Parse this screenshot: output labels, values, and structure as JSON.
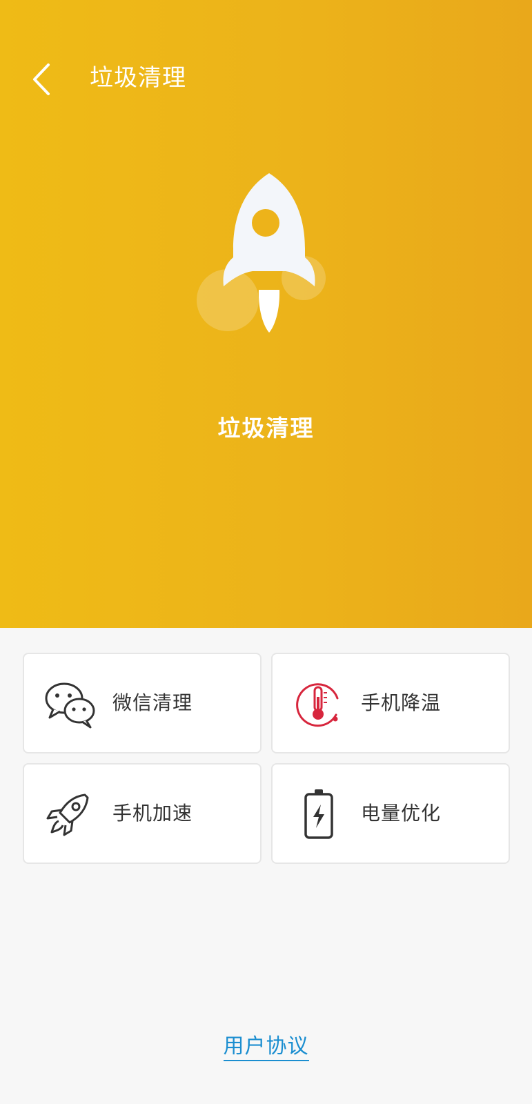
{
  "header": {
    "title": "垃圾清理",
    "back_icon": "chevron-left-icon"
  },
  "hero": {
    "title": "垃圾清理",
    "icon": "rocket-icon"
  },
  "features": [
    {
      "label": "微信清理",
      "icon": "wechat-icon"
    },
    {
      "label": "手机降温",
      "icon": "thermometer-icon"
    },
    {
      "label": "手机加速",
      "icon": "rocket-icon"
    },
    {
      "label": "电量优化",
      "icon": "battery-icon"
    }
  ],
  "footer": {
    "agreement_label": "用户协议"
  },
  "colors": {
    "hero_gradient_start": "#efbb16",
    "hero_gradient_end": "#e9a81b",
    "thermometer_accent": "#d7263d",
    "link": "#1b8ed0",
    "text": "#333333"
  }
}
